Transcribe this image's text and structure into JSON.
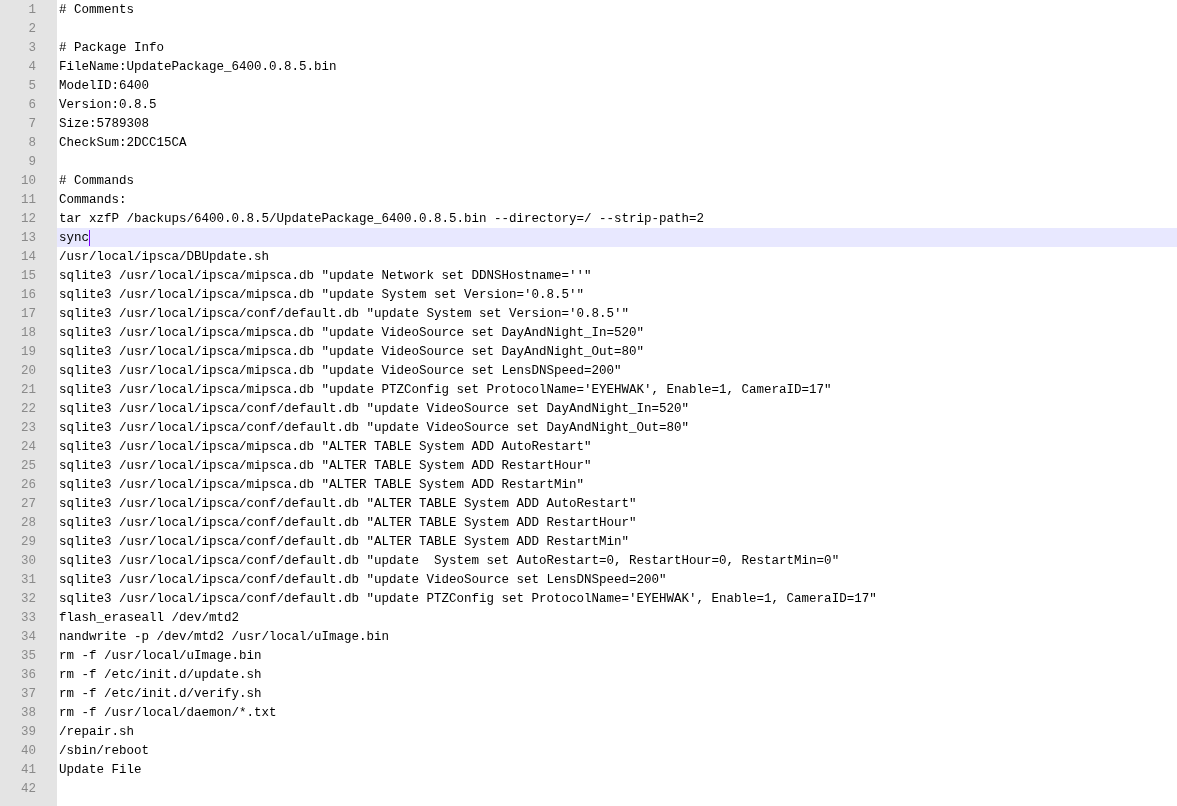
{
  "editor": {
    "lines": [
      {
        "number": "1",
        "text": "# Comments",
        "current": false
      },
      {
        "number": "2",
        "current": false
      },
      {
        "number": "3",
        "text": "# Package Info",
        "current": false
      },
      {
        "number": "4",
        "text": "FileName:UpdatePackage_6400.0.8.5.bin",
        "current": false
      },
      {
        "number": "5",
        "text": "ModelID:6400",
        "current": false
      },
      {
        "number": "6",
        "text": "Version:0.8.5",
        "current": false
      },
      {
        "number": "7",
        "text": "Size:5789308",
        "current": false
      },
      {
        "number": "8",
        "text": "CheckSum:2DCC15CA",
        "current": false
      },
      {
        "number": "9",
        "current": false
      },
      {
        "number": "10",
        "text": "# Commands",
        "current": false
      },
      {
        "number": "11",
        "text": "Commands:",
        "current": false
      },
      {
        "number": "12",
        "text": "tar xzfP /backups/6400.0.8.5/UpdatePackage_6400.0.8.5.bin --directory=/ --strip-path=2",
        "current": false
      },
      {
        "number": "13",
        "text": "sync",
        "current": true
      },
      {
        "number": "14",
        "text": "/usr/local/ipsca/DBUpdate.sh",
        "current": false
      },
      {
        "number": "15",
        "text": "sqlite3 /usr/local/ipsca/mipsca.db \"update Network set DDNSHostname=''\"",
        "current": false
      },
      {
        "number": "16",
        "text": "sqlite3 /usr/local/ipsca/mipsca.db \"update System set Version='0.8.5'\"",
        "current": false
      },
      {
        "number": "17",
        "text": "sqlite3 /usr/local/ipsca/conf/default.db \"update System set Version='0.8.5'\"",
        "current": false
      },
      {
        "number": "18",
        "text": "sqlite3 /usr/local/ipsca/mipsca.db \"update VideoSource set DayAndNight_In=520\"",
        "current": false
      },
      {
        "number": "19",
        "text": "sqlite3 /usr/local/ipsca/mipsca.db \"update VideoSource set DayAndNight_Out=80\"",
        "current": false
      },
      {
        "number": "20",
        "text": "sqlite3 /usr/local/ipsca/mipsca.db \"update VideoSource set LensDNSpeed=200\"",
        "current": false
      },
      {
        "number": "21",
        "text": "sqlite3 /usr/local/ipsca/mipsca.db \"update PTZConfig set ProtocolName='EYEHWAK', Enable=1, CameraID=17\"",
        "current": false
      },
      {
        "number": "22",
        "text": "sqlite3 /usr/local/ipsca/conf/default.db \"update VideoSource set DayAndNight_In=520\"",
        "current": false
      },
      {
        "number": "23",
        "text": "sqlite3 /usr/local/ipsca/conf/default.db \"update VideoSource set DayAndNight_Out=80\"",
        "current": false
      },
      {
        "number": "24",
        "text": "sqlite3 /usr/local/ipsca/mipsca.db \"ALTER TABLE System ADD AutoRestart\"",
        "current": false
      },
      {
        "number": "25",
        "text": "sqlite3 /usr/local/ipsca/mipsca.db \"ALTER TABLE System ADD RestartHour\"",
        "current": false
      },
      {
        "number": "26",
        "text": "sqlite3 /usr/local/ipsca/mipsca.db \"ALTER TABLE System ADD RestartMin\"",
        "current": false
      },
      {
        "number": "27",
        "text": "sqlite3 /usr/local/ipsca/conf/default.db \"ALTER TABLE System ADD AutoRestart\"",
        "current": false
      },
      {
        "number": "28",
        "text": "sqlite3 /usr/local/ipsca/conf/default.db \"ALTER TABLE System ADD RestartHour\"",
        "current": false
      },
      {
        "number": "29",
        "text": "sqlite3 /usr/local/ipsca/conf/default.db \"ALTER TABLE System ADD RestartMin\"",
        "current": false
      },
      {
        "number": "30",
        "text": "sqlite3 /usr/local/ipsca/conf/default.db \"update  System set AutoRestart=0, RestartHour=0, RestartMin=0\"",
        "current": false
      },
      {
        "number": "31",
        "text": "sqlite3 /usr/local/ipsca/conf/default.db \"update VideoSource set LensDNSpeed=200\"",
        "current": false
      },
      {
        "number": "32",
        "text": "sqlite3 /usr/local/ipsca/conf/default.db \"update PTZConfig set ProtocolName='EYEHWAK', Enable=1, CameraID=17\"",
        "current": false
      },
      {
        "number": "33",
        "text": "flash_eraseall /dev/mtd2",
        "current": false
      },
      {
        "number": "34",
        "text": "nandwrite -p /dev/mtd2 /usr/local/uImage.bin",
        "current": false
      },
      {
        "number": "35",
        "text": "rm -f /usr/local/uImage.bin",
        "current": false
      },
      {
        "number": "36",
        "text": "rm -f /etc/init.d/update.sh",
        "current": false
      },
      {
        "number": "37",
        "text": "rm -f /etc/init.d/verify.sh",
        "current": false
      },
      {
        "number": "38",
        "text": "rm -f /usr/local/daemon/*.txt",
        "current": false
      },
      {
        "number": "39",
        "text": "/repair.sh",
        "current": false
      },
      {
        "number": "40",
        "text": "/sbin/reboot",
        "current": false
      },
      {
        "number": "41",
        "text": "Update File",
        "current": false
      },
      {
        "number": "42",
        "current": false
      }
    ]
  }
}
